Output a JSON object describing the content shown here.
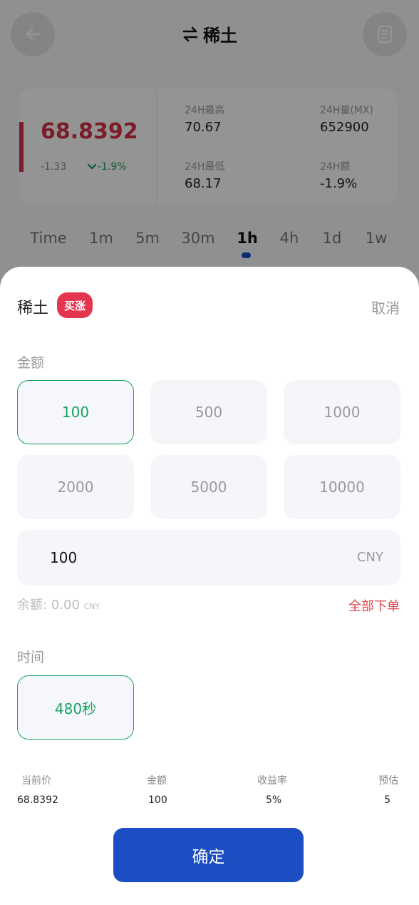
{
  "header": {
    "title": "稀土",
    "swap_icon": "swap-arrows-icon",
    "back_icon": "arrow-left-icon",
    "record_icon": "document-icon"
  },
  "stats": {
    "price": "68.8392",
    "change": "-1.33",
    "change_pct": "-1.9%",
    "high_label": "24H最高",
    "high_value": "70.67",
    "volume_label": "24H量(MX)",
    "volume_value": "652900",
    "low_label": "24H最低",
    "low_value": "68.17",
    "amount_label": "24H额",
    "amount_value": "-1.9%",
    "up_color": "#d53246",
    "down_color": "#1aa260"
  },
  "tabs": [
    "Time",
    "1m",
    "5m",
    "30m",
    "1h",
    "4h",
    "1d",
    "1w"
  ],
  "active_tab": "1h",
  "sheet": {
    "title": "稀土",
    "badge": "买涨",
    "cancel": "取消",
    "amount_label": "金额",
    "amount_options": [
      "100",
      "500",
      "1000",
      "2000",
      "5000",
      "10000"
    ],
    "selected_amount": "100",
    "input_value": "100",
    "input_unit": "CNY",
    "balance_label": "余额:",
    "balance_value": "0.00",
    "balance_unit": "CNY",
    "all_order": "全部下单",
    "time_label": "时间",
    "time_option": "480秒",
    "summary": [
      {
        "label": "当前价",
        "value": "68.8392"
      },
      {
        "label": "金额",
        "value": "100"
      },
      {
        "label": "收益率",
        "value": "5%"
      },
      {
        "label": "预估",
        "value": "5"
      }
    ],
    "confirm": "确定",
    "accent": "#1aa260",
    "button_color": "#1a4ec2"
  }
}
